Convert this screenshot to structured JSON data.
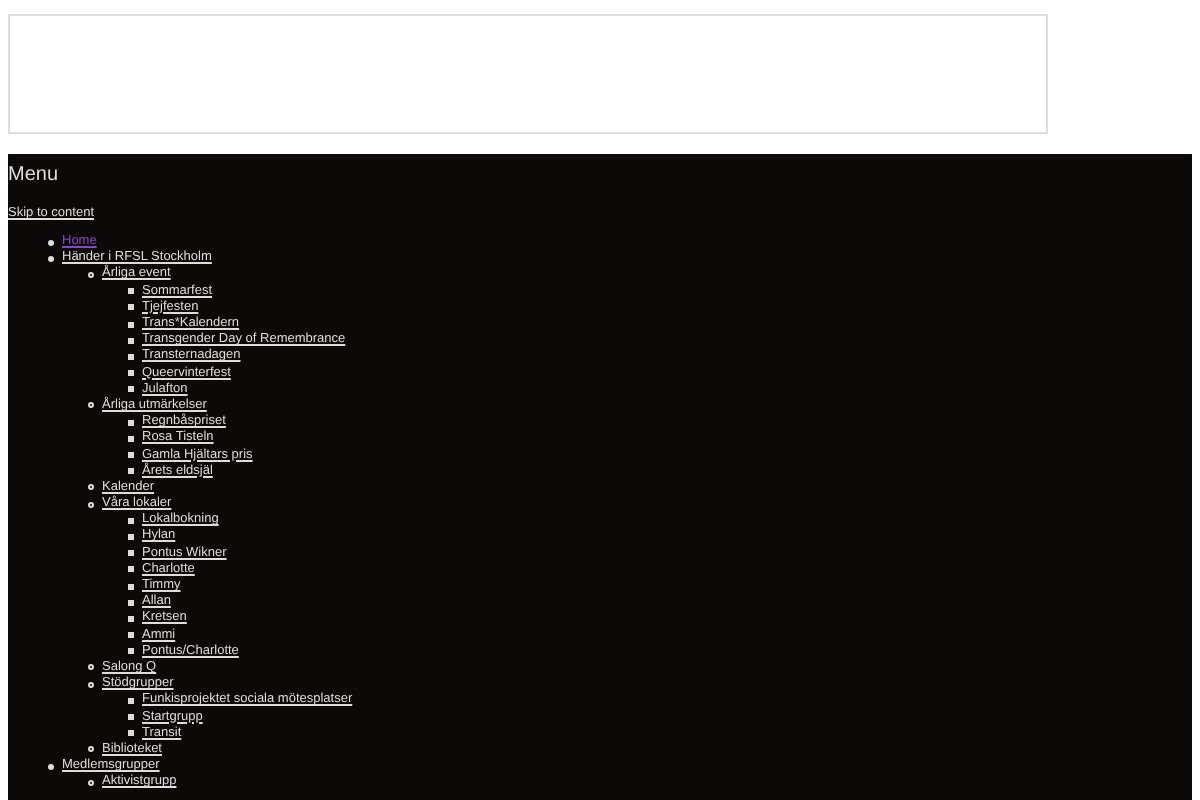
{
  "menu": {
    "title": "Menu",
    "skip_link": "Skip to content",
    "items": [
      {
        "label": "Home",
        "current": true
      },
      {
        "label": "Händer i RFSL Stockholm",
        "current": false,
        "children": [
          {
            "label": "Årliga event",
            "current": false,
            "children": [
              {
                "label": "Sommarfest",
                "current": false
              },
              {
                "label": "Tjejfesten",
                "current": false
              },
              {
                "label": "Trans*Kalendern",
                "current": false
              },
              {
                "label": "Transgender Day of Remembrance",
                "current": false
              },
              {
                "label": "Transternadagen",
                "current": false
              },
              {
                "label": "Queervinterfest",
                "current": false
              },
              {
                "label": "Julafton",
                "current": false
              }
            ]
          },
          {
            "label": "Årliga utmärkelser",
            "current": false,
            "children": [
              {
                "label": "Regnbåspriset",
                "current": false
              },
              {
                "label": "Rosa Tisteln",
                "current": false
              },
              {
                "label": "Gamla Hjältars pris",
                "current": false
              },
              {
                "label": "Årets eldsjäl",
                "current": false
              }
            ]
          },
          {
            "label": "Kalender",
            "current": false
          },
          {
            "label": "Våra lokaler",
            "current": false,
            "children": [
              {
                "label": "Lokalbokning",
                "current": false
              },
              {
                "label": "Hylan",
                "current": false
              },
              {
                "label": "Pontus Wikner",
                "current": false
              },
              {
                "label": "Charlotte",
                "current": false
              },
              {
                "label": "Timmy",
                "current": false
              },
              {
                "label": "Allan",
                "current": false
              },
              {
                "label": "Kretsen",
                "current": false
              },
              {
                "label": "Ammi",
                "current": false
              },
              {
                "label": "Pontus/Charlotte",
                "current": false
              }
            ]
          },
          {
            "label": "Salong Q",
            "current": false
          },
          {
            "label": "Stödgrupper",
            "current": false,
            "children": [
              {
                "label": "Funkisprojektet sociala mötesplatser",
                "current": false
              },
              {
                "label": "Startgrupp",
                "current": false
              },
              {
                "label": "Transit",
                "current": false
              }
            ]
          },
          {
            "label": "Biblioteket",
            "current": false
          }
        ]
      },
      {
        "label": "Medlemsgrupper",
        "current": false,
        "children": [
          {
            "label": "Aktivistgrupp",
            "current": false
          }
        ]
      }
    ]
  }
}
